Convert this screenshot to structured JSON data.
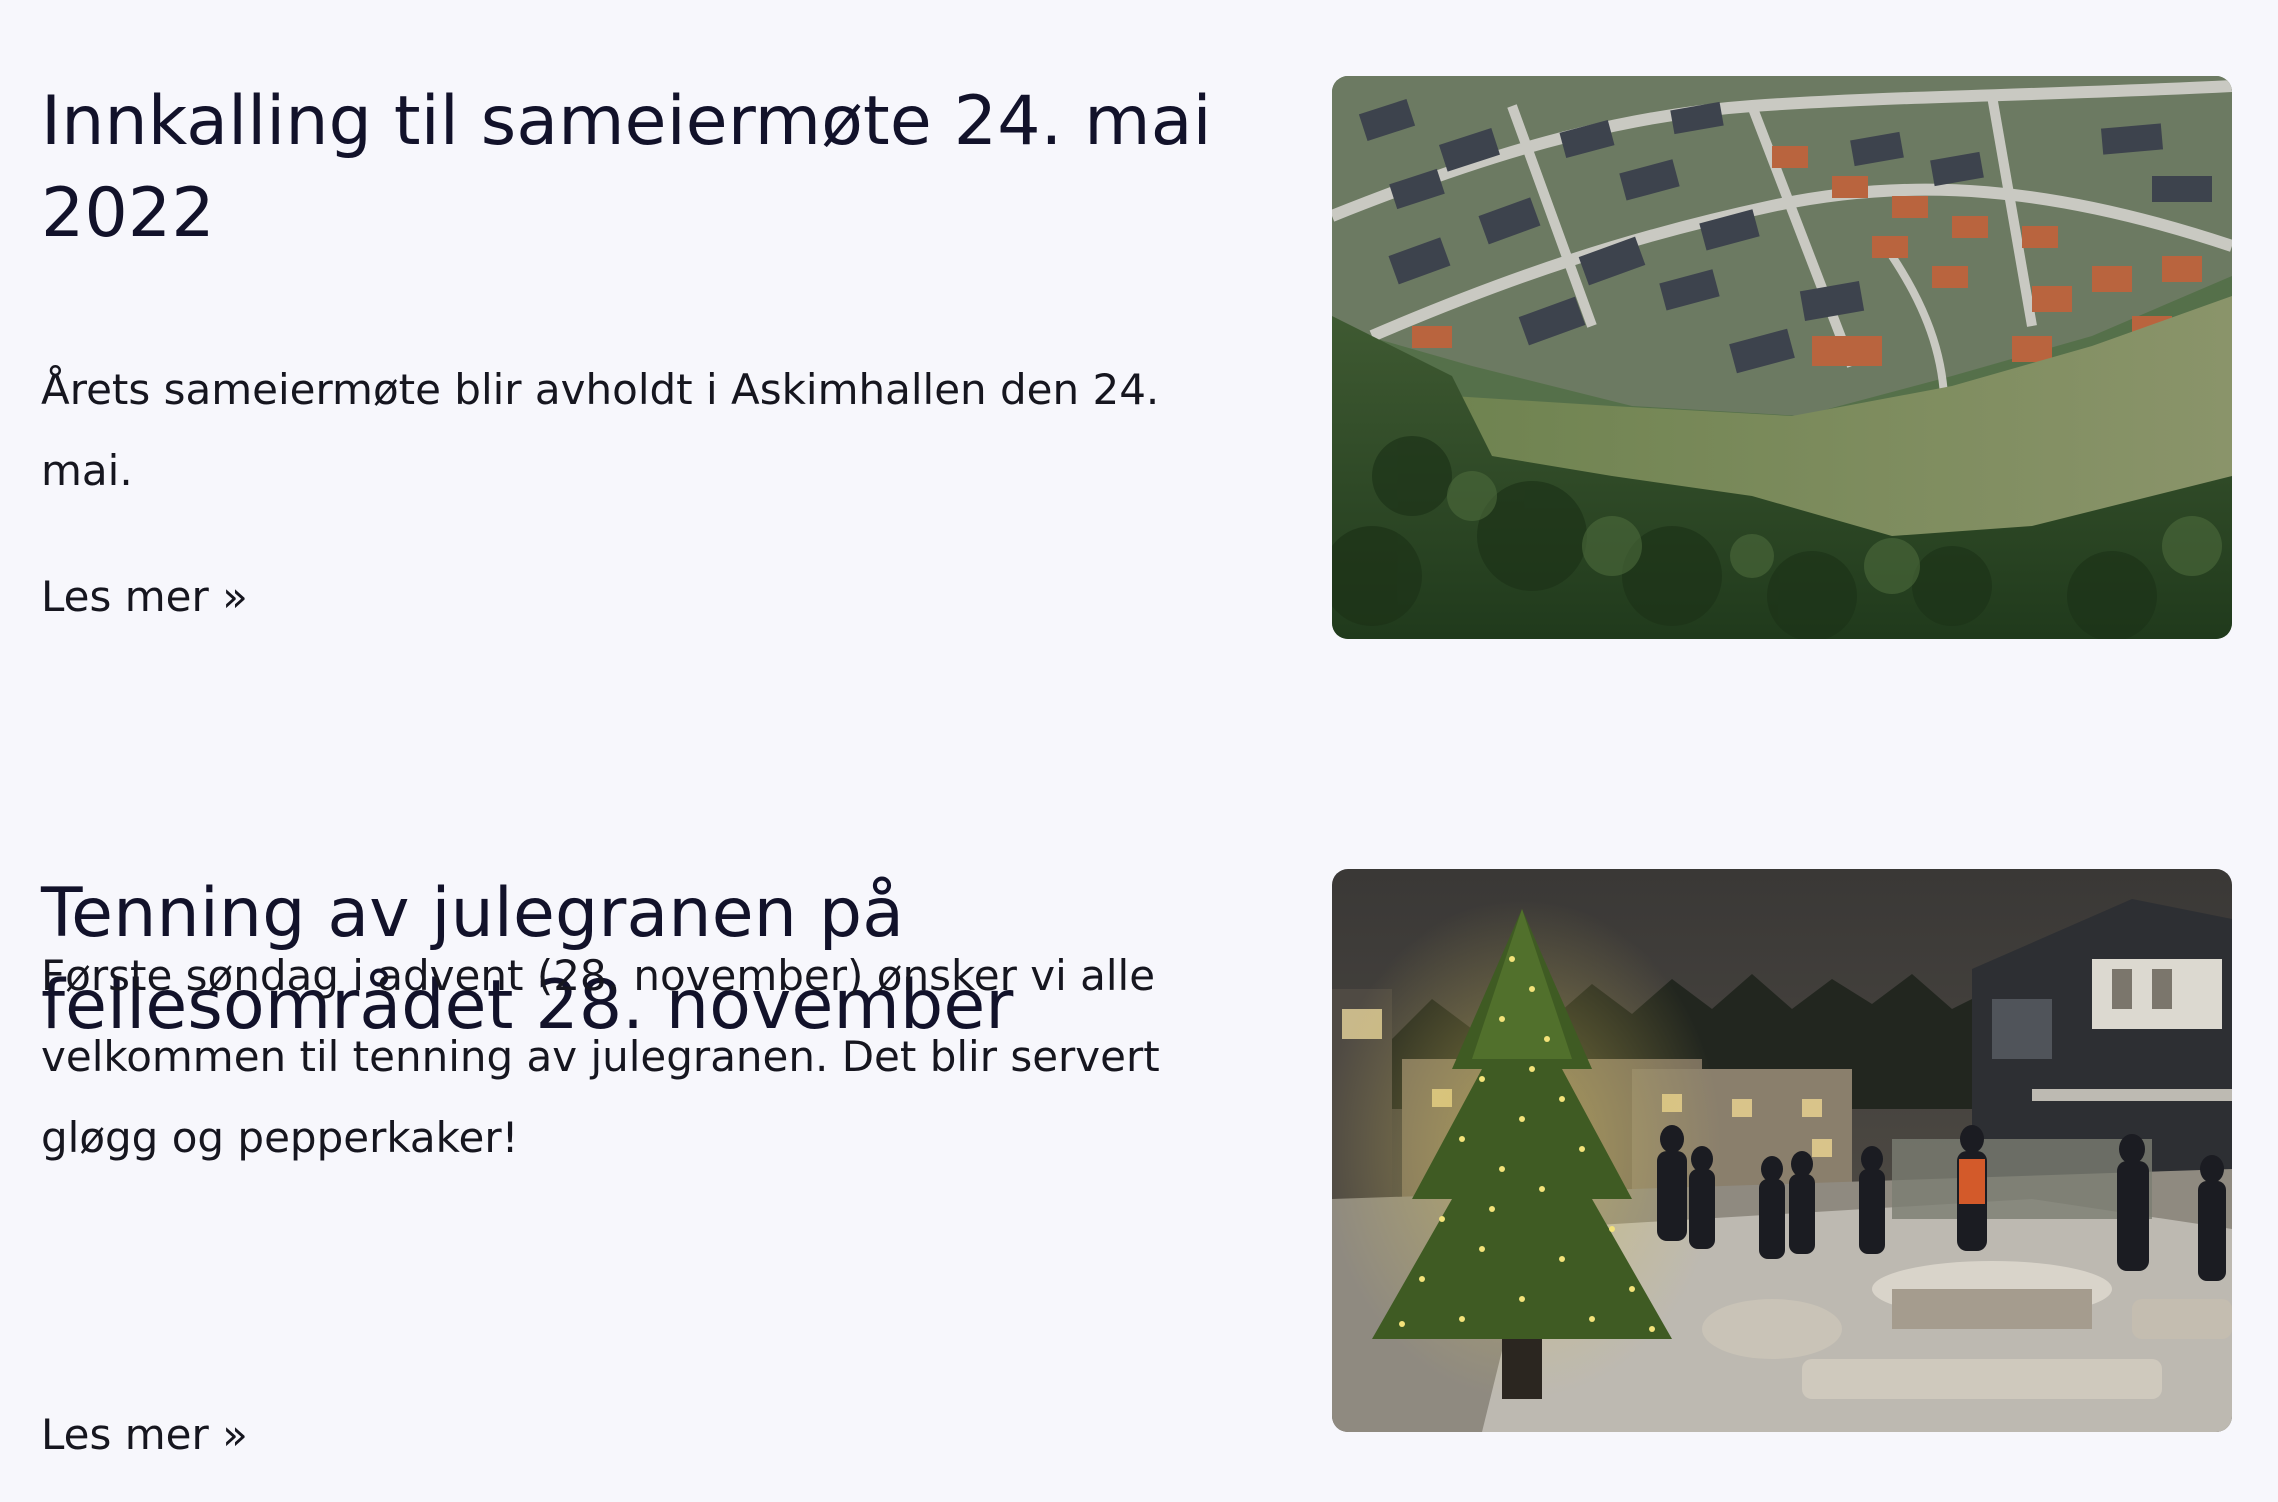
{
  "posts": [
    {
      "title": "Innkalling til sameiermøte 24. mai 2022",
      "excerpt": "Årets sameiermøte blir avholdt i Askimhallen den 24. mai.",
      "read_more": "Les mer »",
      "image": "aerial-neighborhood-photo"
    },
    {
      "title": "Tenning av julegranen på fellesområdet 28. november",
      "excerpt": "Første søndag i advent (28. november) ønsker vi alle velkommen til tenning av julegranen. Det blir servert gløgg og pepperkaker!",
      "read_more": "Les mer »",
      "image": "christmas-tree-lighting-photo"
    }
  ],
  "colors": {
    "background": "#f7f7fc",
    "heading": "#12122a",
    "text": "#16161f"
  }
}
